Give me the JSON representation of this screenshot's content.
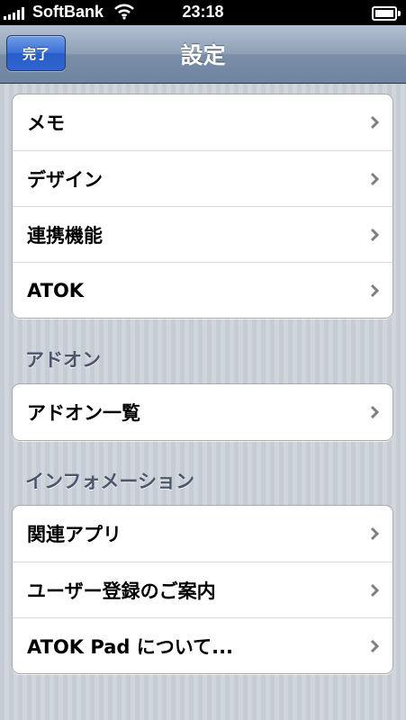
{
  "status_bar": {
    "carrier": "SoftBank",
    "time": "23:18"
  },
  "nav": {
    "done_label": "完了",
    "title": "設定"
  },
  "groups": [
    {
      "items": [
        {
          "label": "メモ"
        },
        {
          "label": "デザイン"
        },
        {
          "label": "連携機能"
        },
        {
          "label": "ATOK"
        }
      ]
    },
    {
      "header": "アドオン",
      "items": [
        {
          "label": "アドオン一覧"
        }
      ]
    },
    {
      "header": "インフォメーション",
      "items": [
        {
          "label": "関連アプリ"
        },
        {
          "label": "ユーザー登録のご案内"
        },
        {
          "label": "ATOK Pad について..."
        }
      ]
    }
  ],
  "icons": {
    "chevron": "chevron-right-icon",
    "wifi": "wifi-icon",
    "battery": "battery-icon",
    "signal": "signal-icon"
  }
}
